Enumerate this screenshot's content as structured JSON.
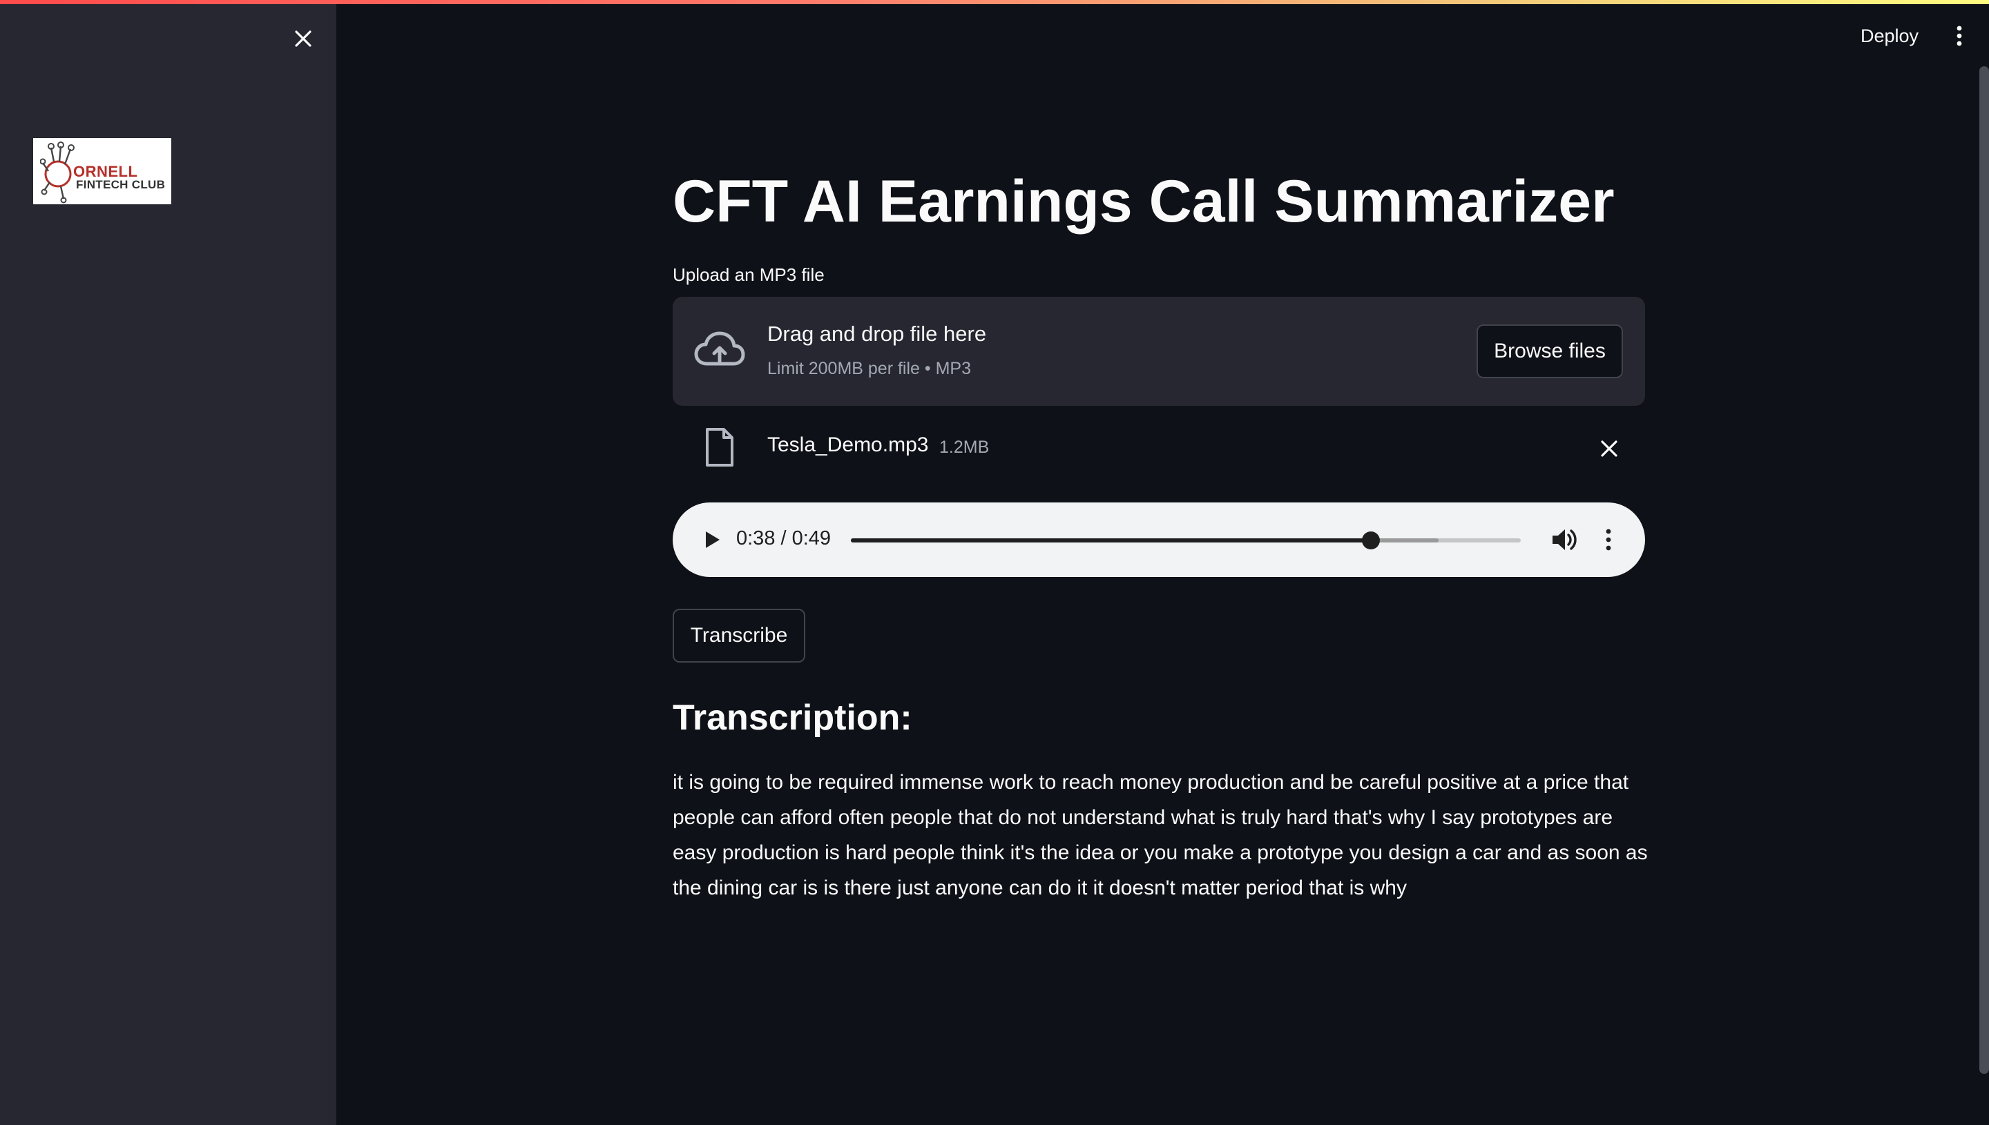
{
  "header": {
    "deploy_label": "Deploy",
    "menu_icon": "vertical-dots-icon"
  },
  "sidebar": {
    "close_icon": "close-icon",
    "logo": {
      "text_line_1": "ORNELL",
      "text_line_2": "FINTECH CLUB"
    }
  },
  "main": {
    "title": "CFT AI Earnings Call Summarizer",
    "uploader": {
      "label": "Upload an MP3 file",
      "drop_title": "Drag and drop file here",
      "drop_subtitle": "Limit 200MB per file • MP3",
      "browse_label": "Browse files",
      "icon": "cloud-upload-icon"
    },
    "file": {
      "name": "Tesla_Demo.mp3",
      "size": "1.2MB",
      "icon": "file-icon"
    },
    "audio": {
      "time_display": "0:38 / 0:49",
      "progress_fraction": 0.776,
      "buffered_fraction": 0.877
    },
    "transcribe_label": "Transcribe",
    "transcription_heading": "Transcription:",
    "transcription_text": "it is going to be required immense work to reach money production and be careful positive at a price that people can afford often people that do not understand what is truly hard that's why I say prototypes are easy production is hard people think it's the idea or you make a prototype you design a car and as soon as the dining car is is there just anyone can do it it doesn't matter period that is why"
  },
  "colors": {
    "background": "#0e1117",
    "sidebar": "#262730",
    "text": "#fafafa",
    "muted_text": "#a3a8b4",
    "audio_bg": "#f1f3f4"
  }
}
